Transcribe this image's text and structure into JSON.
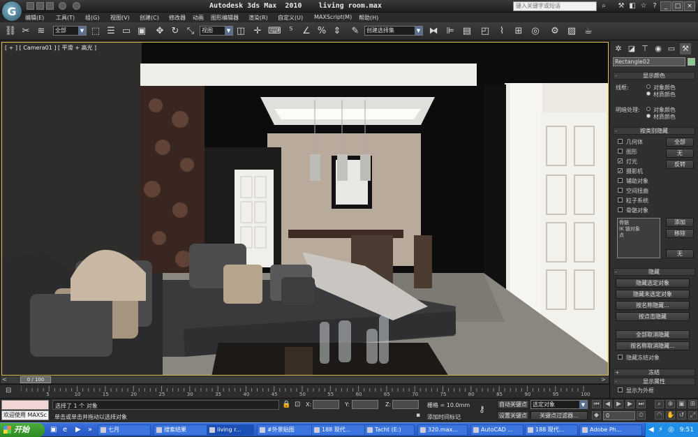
{
  "window": {
    "title": "Autodesk 3ds Max  2010    living room.max",
    "search_placeholder": "键入关键字或短语"
  },
  "menubar": [
    "编辑(E)",
    "工具(T)",
    "组(G)",
    "视图(V)",
    "创建(C)",
    "修改器",
    "动画",
    "图形编辑器",
    "渲染(R)",
    "自定义(U)",
    "MAXScript(M)",
    "帮助(H)"
  ],
  "toolbar": {
    "selection_filter": "全部",
    "reference_coord": "视图",
    "named_selection": "创建选择集"
  },
  "viewport": {
    "label": "[ + ] [ Camera01 ] [ 平滑 + 高光 ]"
  },
  "command_panel": {
    "object_name": "Rectangle02",
    "object_color": "#8ec88e",
    "display_color": {
      "header": "显示颜色",
      "wireframe_label": "线框:",
      "shaded_label": "明暗处理:",
      "option_object_color": "对象颜色",
      "option_material_color": "材质颜色"
    },
    "hide_by_category": {
      "header": "按类别隐藏",
      "categories": [
        {
          "label": "几何体",
          "checked": false
        },
        {
          "label": "图形",
          "checked": false
        },
        {
          "label": "灯光",
          "checked": true
        },
        {
          "label": "摄影机",
          "checked": true
        },
        {
          "label": "辅助对象",
          "checked": false
        },
        {
          "label": "空间扭曲",
          "checked": false
        },
        {
          "label": "粒子系统",
          "checked": false
        },
        {
          "label": "骨骼对象",
          "checked": false
        }
      ],
      "btn_all": "全部",
      "btn_none": "无",
      "btn_invert": "反转",
      "list": [
        "骨骼",
        "IK 链对象",
        "点"
      ],
      "btn_add": "添加",
      "btn_remove": "移除",
      "btn_none2": "无"
    },
    "hide": {
      "header": "隐藏",
      "buttons": [
        "隐藏选定对象",
        "隐藏未选定对象",
        "按名称隐藏...",
        "按点击隐藏",
        "全部取消隐藏",
        "按名称取消隐藏..."
      ],
      "hide_frozen": "隐藏冻结对象"
    },
    "freeze_header": "冻结",
    "display_props": {
      "header": "显示属性",
      "display_as_box": "显示为外框"
    }
  },
  "timeline": {
    "frame_readout": "0 / 100",
    "ticks": [
      "5",
      "10",
      "15",
      "20",
      "25",
      "30",
      "35",
      "40",
      "45",
      "50",
      "55",
      "60",
      "65",
      "70",
      "75",
      "80",
      "85",
      "90",
      "95",
      "100"
    ]
  },
  "status": {
    "maxscript_text": "欢迎使用 MAXSc",
    "selected": "选择了 1 个 对象",
    "prompt": "单击或单击并拖动以选择对象",
    "x_label": "X:",
    "y_label": "Y:",
    "z_label": "Z:",
    "grid": "栅格 = 10.0mm",
    "add_time_tag": "添加时间标记",
    "auto_key": "自动关键点",
    "set_key": "设置关键点",
    "selection_dropdown": "选定对象",
    "key_filters": "关键点过滤器...",
    "current_frame": "0"
  },
  "taskbar": {
    "start": "开始",
    "items": [
      "七月",
      "搜索结果",
      "living r...",
      "#外景贴图",
      "188 现代...",
      "Tacht (E:)",
      "320.max...",
      "AutoCAD ...",
      "188 现代...",
      "Adobe Ph..."
    ],
    "clock": "9:51"
  }
}
